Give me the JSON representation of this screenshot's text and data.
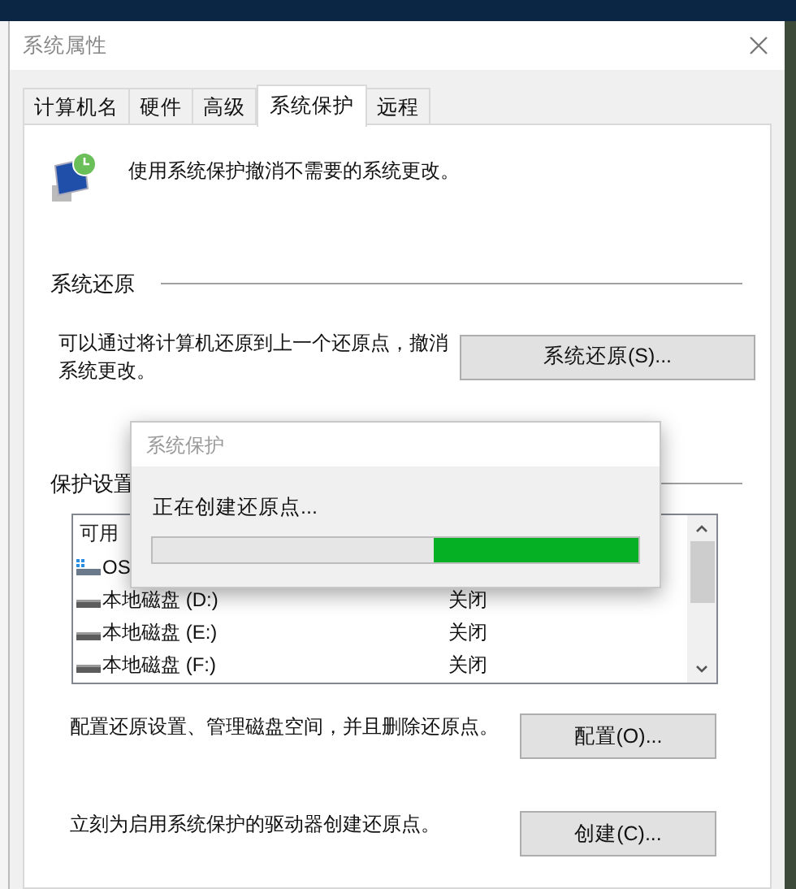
{
  "window": {
    "title": "系统属性"
  },
  "tabs": [
    {
      "label": "计算机名",
      "selected": false
    },
    {
      "label": "硬件",
      "selected": false
    },
    {
      "label": "高级",
      "selected": false
    },
    {
      "label": "系统保护",
      "selected": true
    },
    {
      "label": "远程",
      "selected": false
    }
  ],
  "description": "使用系统保护撤消不需要的系统更改。",
  "system_restore": {
    "heading": "系统还原",
    "text": "可以通过将计算机还原到上一个还原点，撤消系统更改。",
    "button": "系统还原(S)..."
  },
  "protection_settings": {
    "heading": "保护设置",
    "list": {
      "header": "可用",
      "rows": [
        {
          "kind": "system",
          "name": "OS"
        },
        {
          "kind": "local",
          "name": "本地磁盘 (D:)",
          "status": "关闭"
        },
        {
          "kind": "local",
          "name": "本地磁盘 (E:)",
          "status": "关闭"
        },
        {
          "kind": "local",
          "name": "本地磁盘 (F:)",
          "status": "关闭"
        }
      ]
    }
  },
  "configure": {
    "text": "配置还原设置、管理磁盘空间，并且删除还原点。",
    "button": "配置(O)..."
  },
  "create": {
    "text": "立刻为启用系统保护的驱动器创建还原点。",
    "button": "创建(C)..."
  },
  "progress_dialog": {
    "title": "系统保护",
    "message": "正在创建还原点...",
    "progress": {
      "kind": "marquee",
      "level": 0.42
    }
  }
}
